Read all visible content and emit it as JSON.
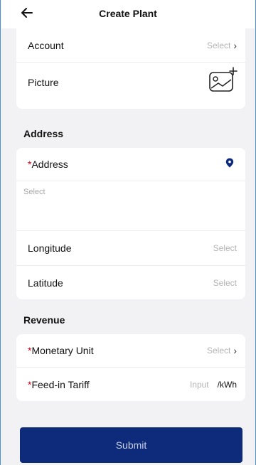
{
  "header": {
    "title": "Create Plant"
  },
  "card1": {
    "account_label": "Account",
    "account_value": "Select",
    "picture_label": "Picture"
  },
  "address_section": {
    "title": "Address",
    "address_label": "Address",
    "required_mark": "*",
    "address_placeholder": "Select",
    "longitude_label": "Longitude",
    "longitude_value": "Select",
    "latitude_label": "Latitude",
    "latitude_value": "Select"
  },
  "revenue_section": {
    "title": "Revenue",
    "monetary_label": "Monetary Unit",
    "monetary_value": "Select",
    "tariff_label": "Feed-in Tariff",
    "tariff_value": "Input",
    "tariff_unit": "/kWh",
    "required_mark": "*"
  },
  "submit_label": "Submit",
  "colors": {
    "primary": "#0d2b7a",
    "required": "#d0021b",
    "pin": "#0d2b7a"
  },
  "icons": [
    "arrow-left-icon",
    "chevron-right-icon",
    "add-picture-icon",
    "location-pin-icon"
  ]
}
